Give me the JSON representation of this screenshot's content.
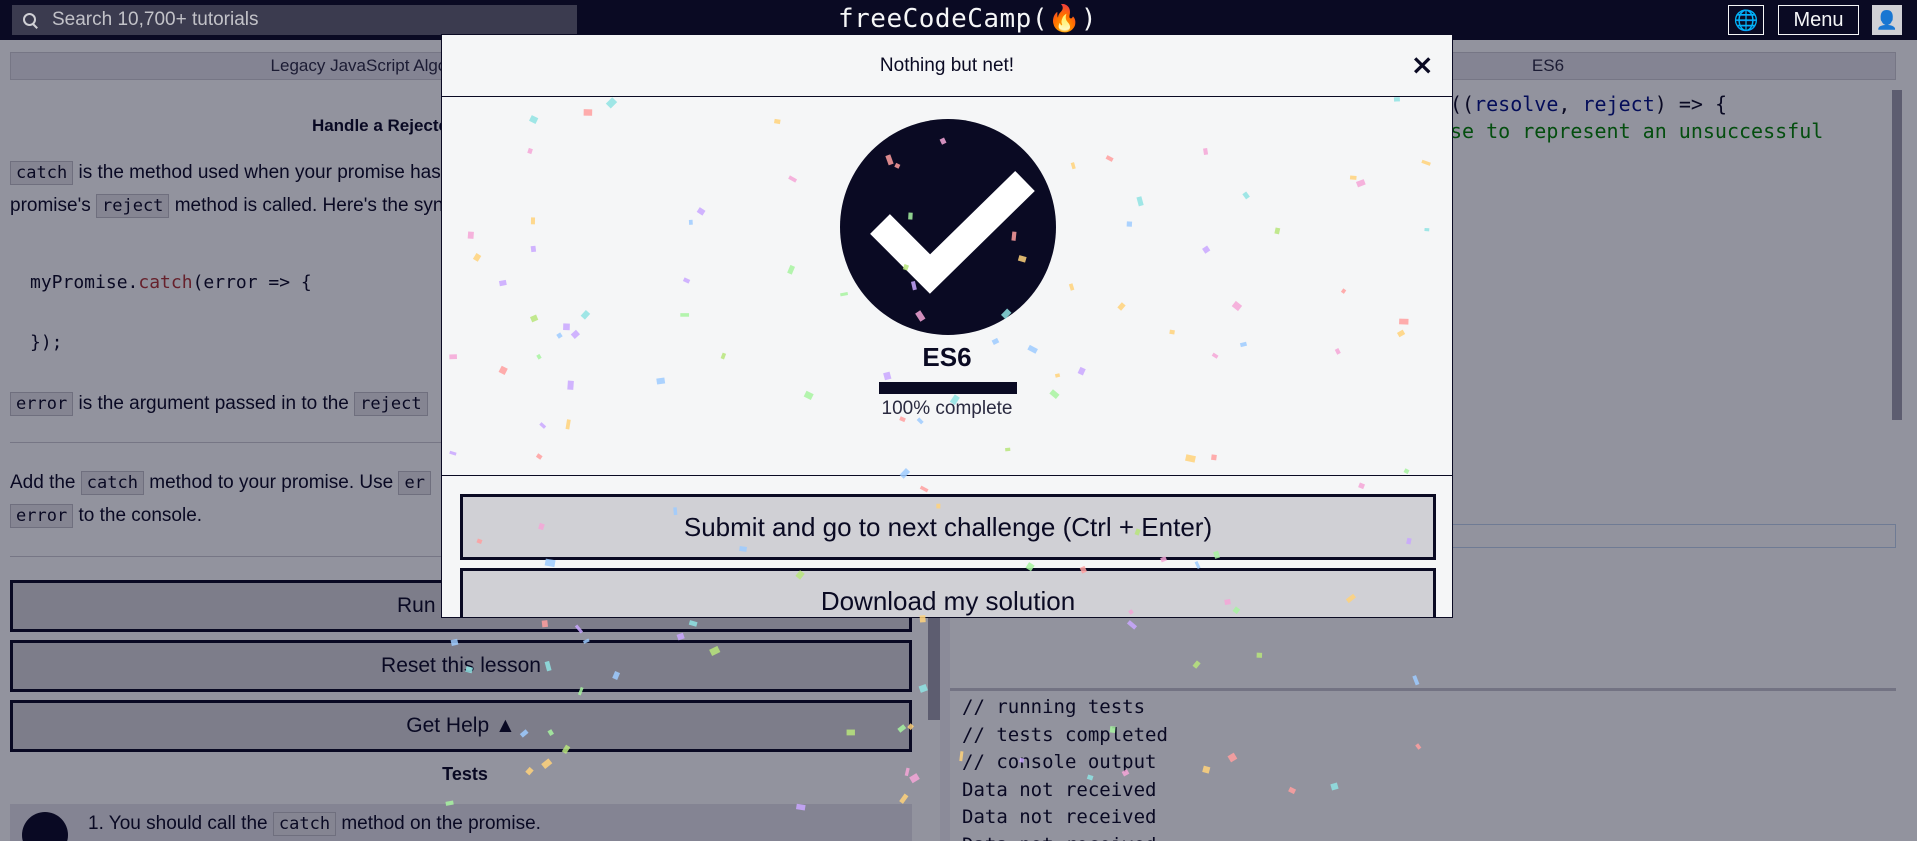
{
  "nav": {
    "search_placeholder": "Search 10,700+ tutorials",
    "logo": "freeCodeCamp(🔥)",
    "menu_label": "Menu"
  },
  "breadcrumb": {
    "left": "Legacy JavaScript Algorithms and Data Structures",
    "right": "ES6"
  },
  "challenge": {
    "title": "Handle a Rejected Promise with catch",
    "p1_code": "catch",
    "p1_text": "is the method used when your promise has been rejected. It is executed immediately after a",
    "p1b_text": "promise's",
    "p1b_code": "reject",
    "p1b_rest": "method is called. Here's the syntax:",
    "code_line1_obj": "myPromise.",
    "code_line1_fn": "catch",
    "code_line1_rest": "(error => {",
    "code_line2": "});",
    "p2_code": "error",
    "p2_text": "is the argument passed in to the",
    "p2_code2": "reject",
    "p3_text": "Add the",
    "p3_code": "catch",
    "p3_rest": "method to your promise. Use",
    "p3_code2": "er",
    "p3b_code": "error",
    "p3b_text": "to the console."
  },
  "buttons": {
    "run": "Run the Tests",
    "reset": "Reset this lesson",
    "help": "Get Help ▲"
  },
  "tests": {
    "title": "Tests",
    "item1_prefix": "1. You should call the",
    "item1_code": "catch",
    "item1_suffix": "method on the promise."
  },
  "editor": {
    "line1_a": "((",
    "line1_b": "resolve",
    "line1_c": ", ",
    "line1_d": "reject",
    "line1_e": ") => {",
    "line2": "se to represent an unsuccessful"
  },
  "console": {
    "lines": [
      "// running tests",
      "// tests completed",
      "// console output",
      "Data not received",
      "Data not received",
      "Data not received"
    ]
  },
  "modal": {
    "title": "Nothing but net!",
    "close": "×",
    "cert_title": "ES6",
    "progress_percent": 100,
    "progress_label": "100% complete",
    "submit_label": "Submit and go to next challenge (Ctrl + Enter)",
    "download_label": "Download my solution"
  },
  "colors": {
    "nav_bg": "#0a0a23",
    "button_bg": "#d0d0d5",
    "overlay": "#0a0a23"
  }
}
